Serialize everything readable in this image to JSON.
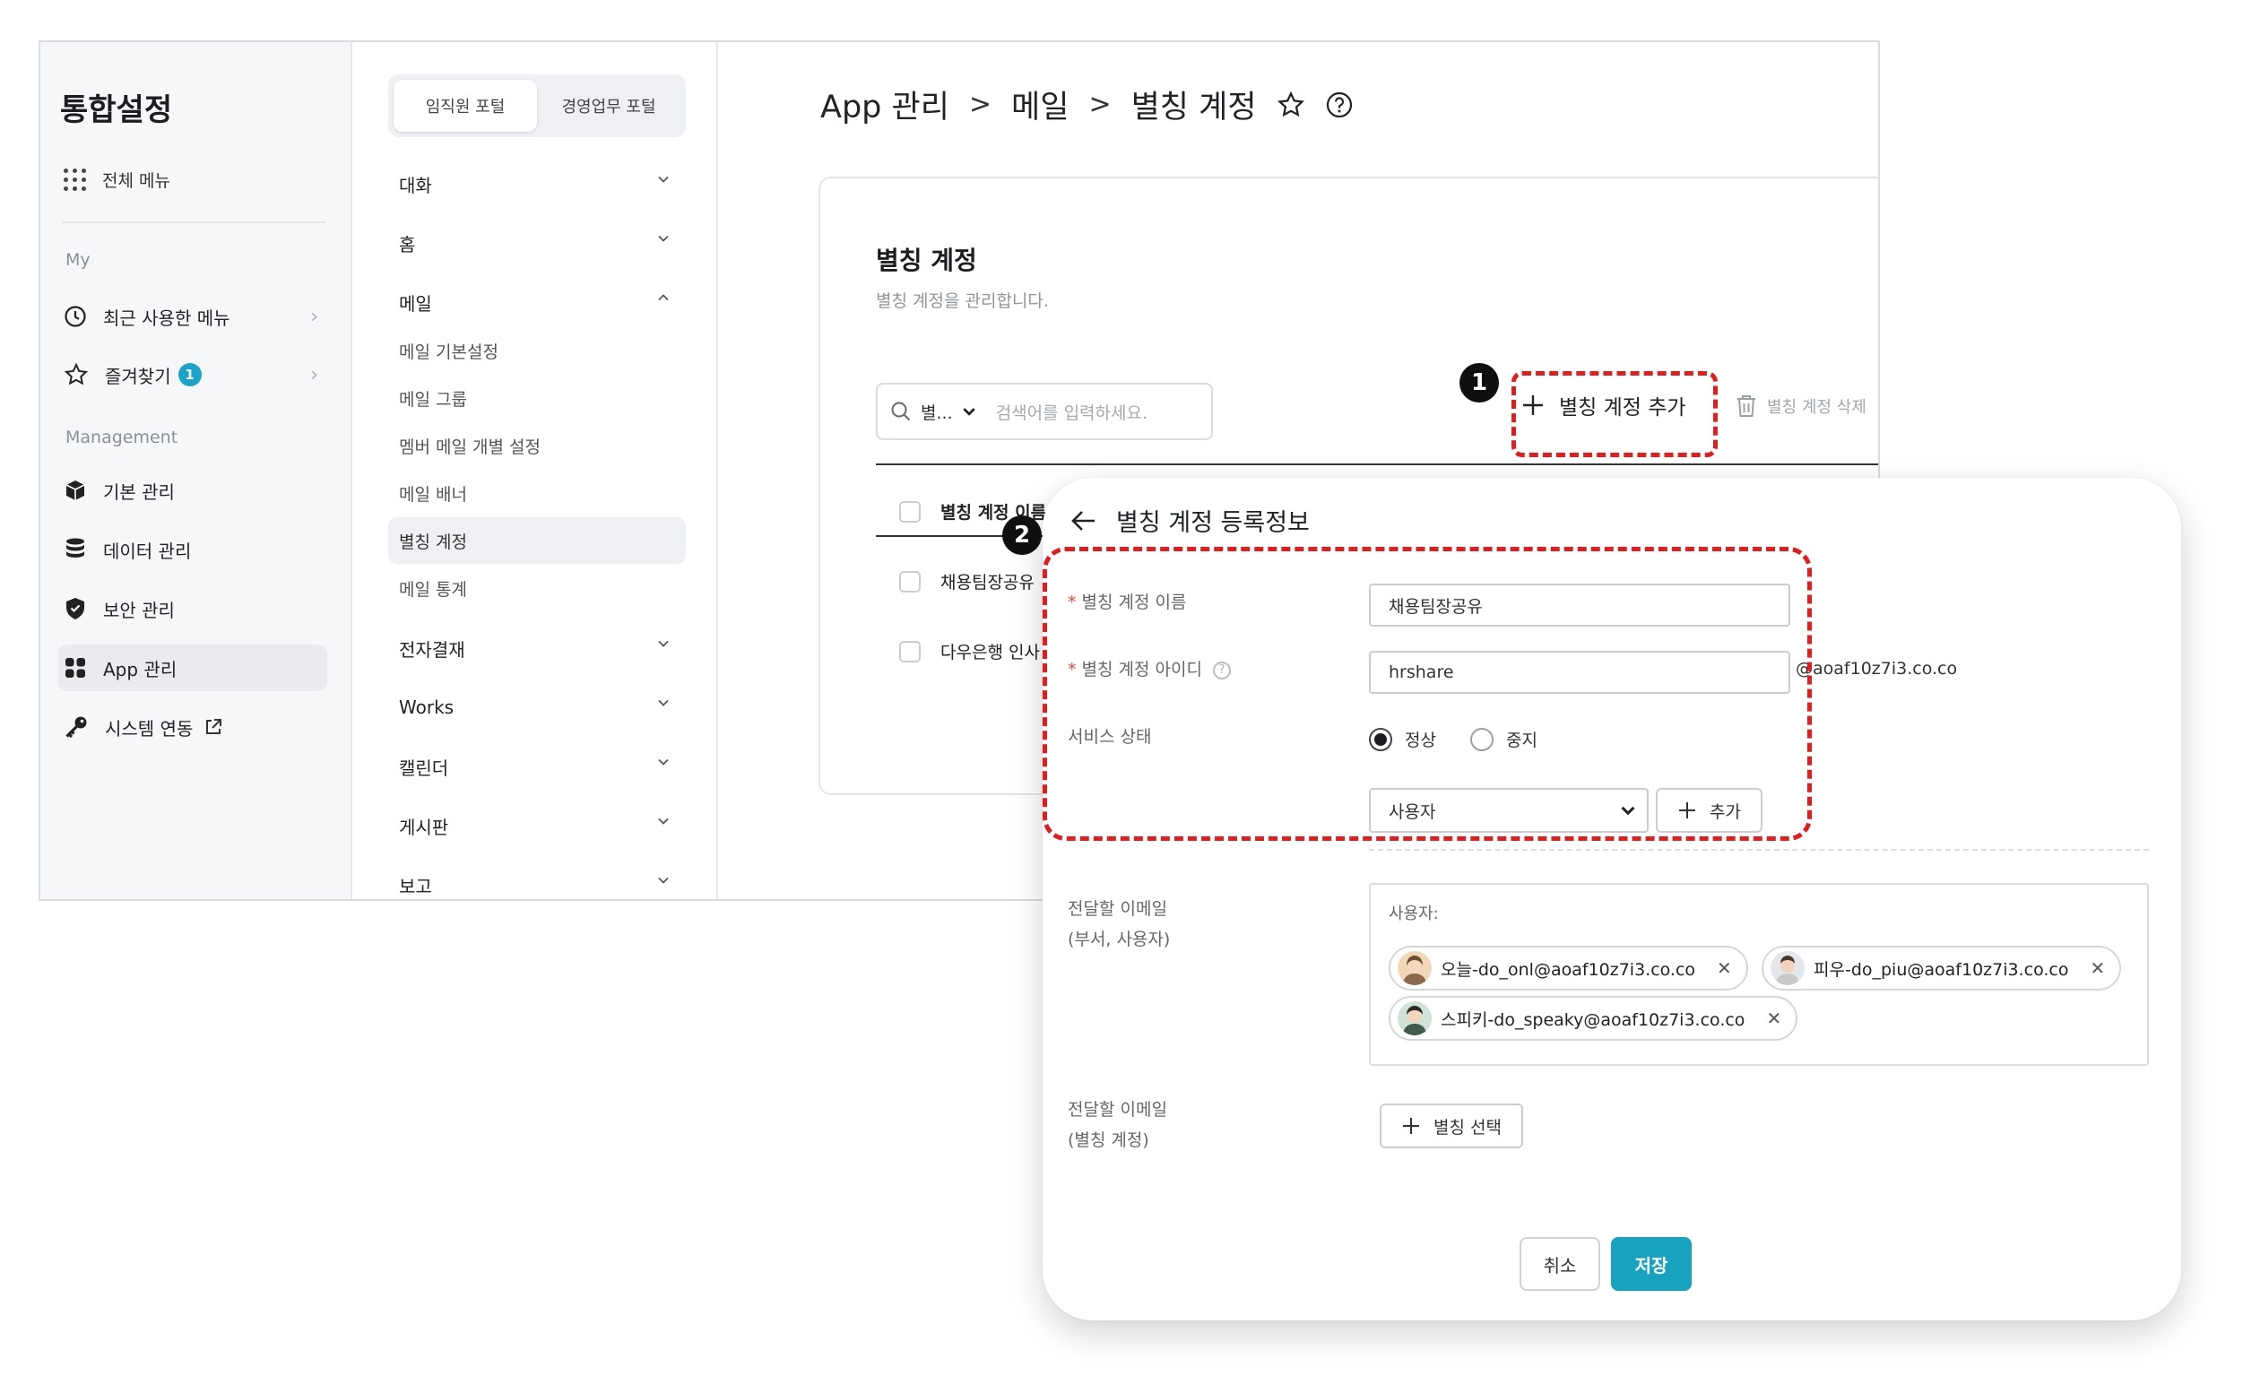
{
  "sidebar": {
    "title": "통합설정",
    "all_menu": "전체 메뉴",
    "section_my": "My",
    "recent": "최근 사용한 메뉴",
    "favorites": "즐겨찾기",
    "favorites_badge": "1",
    "section_mgmt": "Management",
    "items": [
      {
        "label": "기본 관리"
      },
      {
        "label": "데이터 관리"
      },
      {
        "label": "보안 관리"
      },
      {
        "label": "App 관리"
      },
      {
        "label": "시스템 연동"
      }
    ]
  },
  "submenu": {
    "portal_tabs": [
      "임직원 포털",
      "경영업무 포털"
    ],
    "groups": [
      "대화",
      "홈",
      "메일",
      "전자결재",
      "Works",
      "캘린더",
      "게시판",
      "보고"
    ],
    "mail_items": [
      "메일 기본설정",
      "메일 그룹",
      "멤버 메일 개별 설정",
      "메일 배너",
      "별칭 계정",
      "메일 통계"
    ]
  },
  "breadcrumb": {
    "a": "App 관리",
    "b": "메일",
    "c": "별칭 계정"
  },
  "card": {
    "title": "별칭 계정",
    "desc": "별칭 계정을 관리합니다.",
    "search_filter": "별...",
    "search_placeholder": "검색어를 입력하세요.",
    "add_label": "별칭 계정 추가",
    "delete_label": "별칭 계정 삭제",
    "col_header": "별칭 계정 이름",
    "rows": [
      "채용팀장공유",
      "다우은행 인사"
    ]
  },
  "annotations": {
    "one": "1",
    "two": "2"
  },
  "modal": {
    "title": "별칭 계정 등록정보",
    "name_label": "별칭 계정 이름",
    "name_value": "채용팀장공유",
    "id_label": "별칭 계정 아이디",
    "id_value": "hrshare",
    "domain": "@aoaf10z7i3.co.co",
    "status_label": "서비스 상태",
    "status_on": "정상",
    "status_off": "중지",
    "select_value": "사용자",
    "add_label": "추가",
    "forward_label_1": "전달할 이메일",
    "forward_label_1b": "(부서, 사용자)",
    "recipients_label": "사용자:",
    "recipients": [
      "오늘-do_onl@aoaf10z7i3.co.co",
      "피우-do_piu@aoaf10z7i3.co.co",
      "스피키-do_speaky@aoaf10z7i3.co.co"
    ],
    "forward_label_2": "전달할 이메일",
    "forward_label_2b": "(별칭 계정)",
    "alias_select": "별칭 선택",
    "cancel": "취소",
    "save": "저장"
  },
  "colors": {
    "accent": "#17a3bf",
    "annotation": "#e11d1d"
  }
}
